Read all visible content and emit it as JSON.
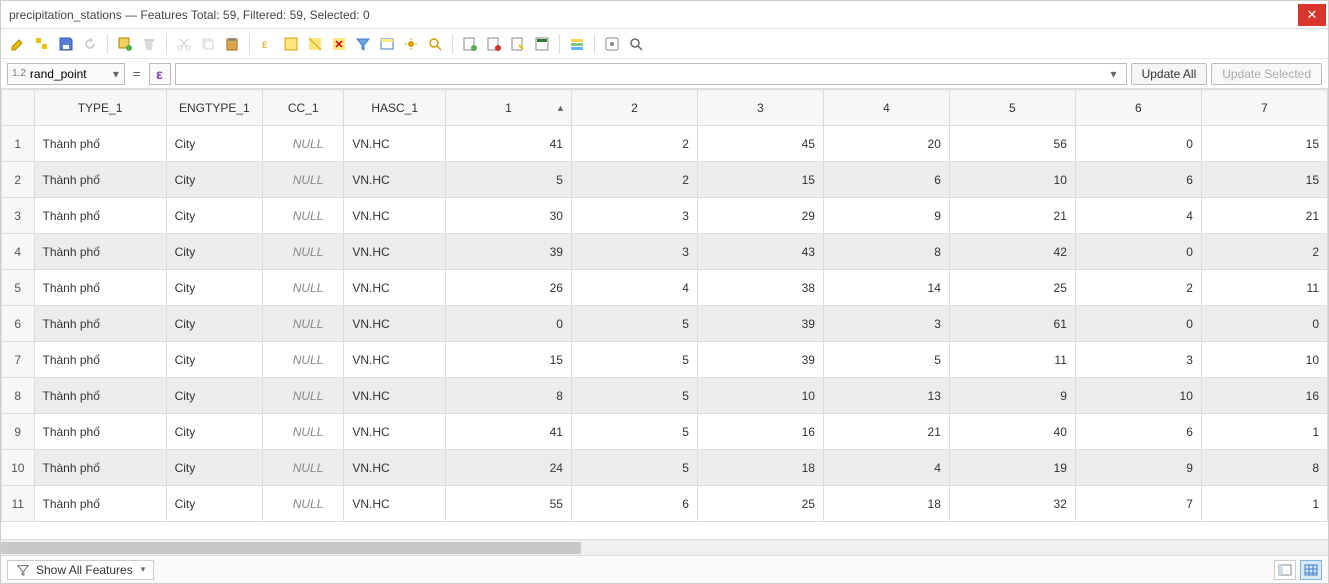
{
  "window": {
    "title": "precipitation_stations — Features Total: 59, Filtered: 59, Selected: 0"
  },
  "exprbar": {
    "field_prefix": "1.2",
    "field_name": "rand_point",
    "eq": "=",
    "epsilon": "ε",
    "update_all": "Update All",
    "update_selected": "Update Selected"
  },
  "columns": [
    "TYPE_1",
    "ENGTYPE_1",
    "CC_1",
    "HASC_1",
    "1",
    "2",
    "3",
    "4",
    "5",
    "6",
    "7"
  ],
  "sort_col_index": 4,
  "rows": [
    {
      "n": 1,
      "c": [
        "Thành phố",
        "City",
        null,
        "VN.HC",
        41,
        2,
        45,
        20,
        56,
        0,
        15
      ]
    },
    {
      "n": 2,
      "c": [
        "Thành phố",
        "City",
        null,
        "VN.HC",
        5,
        2,
        15,
        6,
        10,
        6,
        15
      ]
    },
    {
      "n": 3,
      "c": [
        "Thành phố",
        "City",
        null,
        "VN.HC",
        30,
        3,
        29,
        9,
        21,
        4,
        21
      ]
    },
    {
      "n": 4,
      "c": [
        "Thành phố",
        "City",
        null,
        "VN.HC",
        39,
        3,
        43,
        8,
        42,
        0,
        2
      ]
    },
    {
      "n": 5,
      "c": [
        "Thành phố",
        "City",
        null,
        "VN.HC",
        26,
        4,
        38,
        14,
        25,
        2,
        11
      ]
    },
    {
      "n": 6,
      "c": [
        "Thành phố",
        "City",
        null,
        "VN.HC",
        0,
        5,
        39,
        3,
        61,
        0,
        0
      ]
    },
    {
      "n": 7,
      "c": [
        "Thành phố",
        "City",
        null,
        "VN.HC",
        15,
        5,
        39,
        5,
        11,
        3,
        10
      ]
    },
    {
      "n": 8,
      "c": [
        "Thành phố",
        "City",
        null,
        "VN.HC",
        8,
        5,
        10,
        13,
        9,
        10,
        16
      ]
    },
    {
      "n": 9,
      "c": [
        "Thành phố",
        "City",
        null,
        "VN.HC",
        41,
        5,
        16,
        21,
        40,
        6,
        1
      ]
    },
    {
      "n": 10,
      "c": [
        "Thành phố",
        "City",
        null,
        "VN.HC",
        24,
        5,
        18,
        4,
        19,
        9,
        8
      ]
    },
    {
      "n": 11,
      "c": [
        "Thành phố",
        "City",
        null,
        "VN.HC",
        55,
        6,
        25,
        18,
        32,
        7,
        1
      ]
    }
  ],
  "null_label": "NULL",
  "status": {
    "show_all": "Show All Features"
  }
}
